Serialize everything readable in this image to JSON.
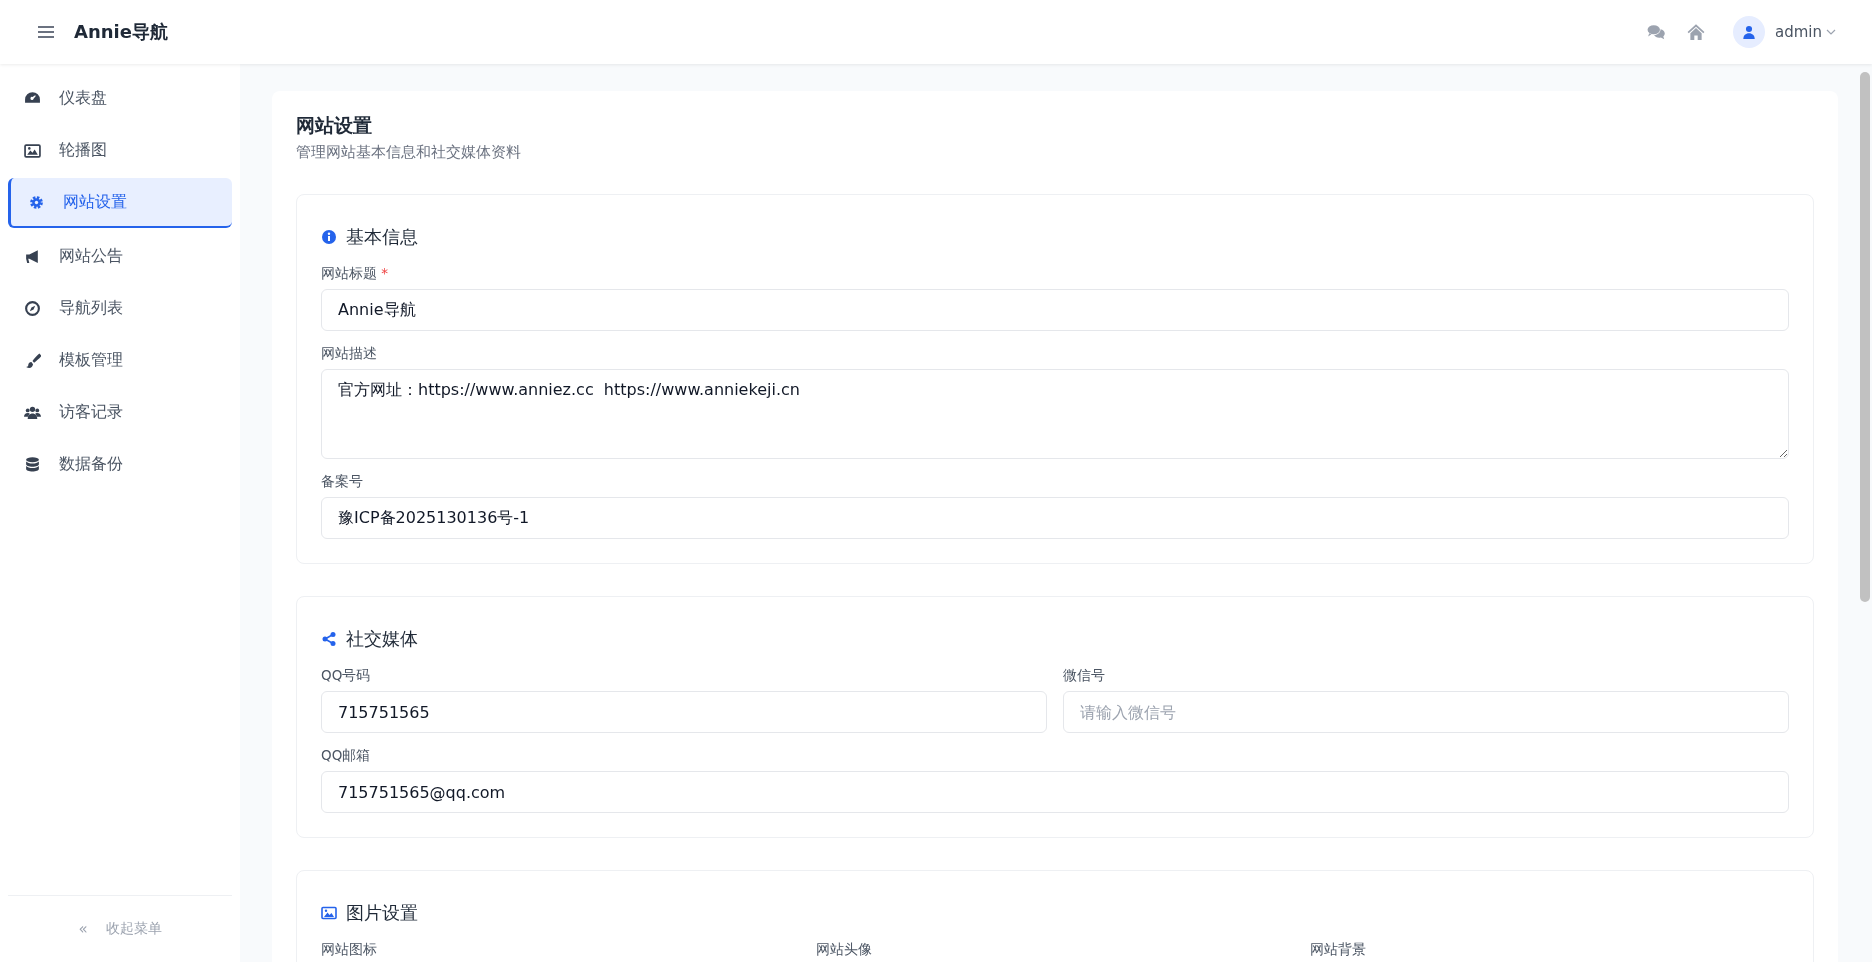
{
  "header": {
    "brand": "Annie导航",
    "user": "admin"
  },
  "sidebar": {
    "items": [
      {
        "label": "仪表盘",
        "selected": false
      },
      {
        "label": "轮播图",
        "selected": false
      },
      {
        "label": "网站设置",
        "selected": true
      },
      {
        "label": "网站公告",
        "selected": false
      },
      {
        "label": "导航列表",
        "selected": false
      },
      {
        "label": "模板管理",
        "selected": false
      },
      {
        "label": "访客记录",
        "selected": false
      },
      {
        "label": "数据备份",
        "selected": false
      }
    ],
    "collapse": {
      "icon": "«",
      "label": "收起菜单"
    }
  },
  "page": {
    "title": "网站设置",
    "subtitle": "管理网站基本信息和社交媒体资料"
  },
  "sections": [
    {
      "title": "基本信息",
      "rows": [
        [
          {
            "label": "网站标题",
            "required_mark": "*",
            "kind": "input",
            "value": "Annie导航"
          }
        ],
        [
          {
            "label": "网站描述",
            "kind": "textarea",
            "value": "官方网址：https://www.anniez.cc  https://www.anniekeji.cn"
          }
        ],
        [
          {
            "label": "备案号",
            "kind": "input",
            "value": "豫ICP备2025130136号-1"
          }
        ]
      ]
    },
    {
      "title": "社交媒体",
      "rows": [
        [
          {
            "label": "QQ号码",
            "kind": "input",
            "value": "715751565"
          },
          {
            "label": "微信号",
            "kind": "input",
            "placeholder": "请输入微信号"
          }
        ],
        [
          {
            "label": "QQ邮箱",
            "kind": "input",
            "value": "715751565@qq.com"
          }
        ]
      ]
    },
    {
      "title": "图片设置",
      "rows": [
        [
          {
            "label": "网站图标",
            "kind": "label"
          },
          {
            "label": "网站头像",
            "kind": "label"
          },
          {
            "label": "网站背景",
            "kind": "label"
          }
        ]
      ]
    }
  ]
}
